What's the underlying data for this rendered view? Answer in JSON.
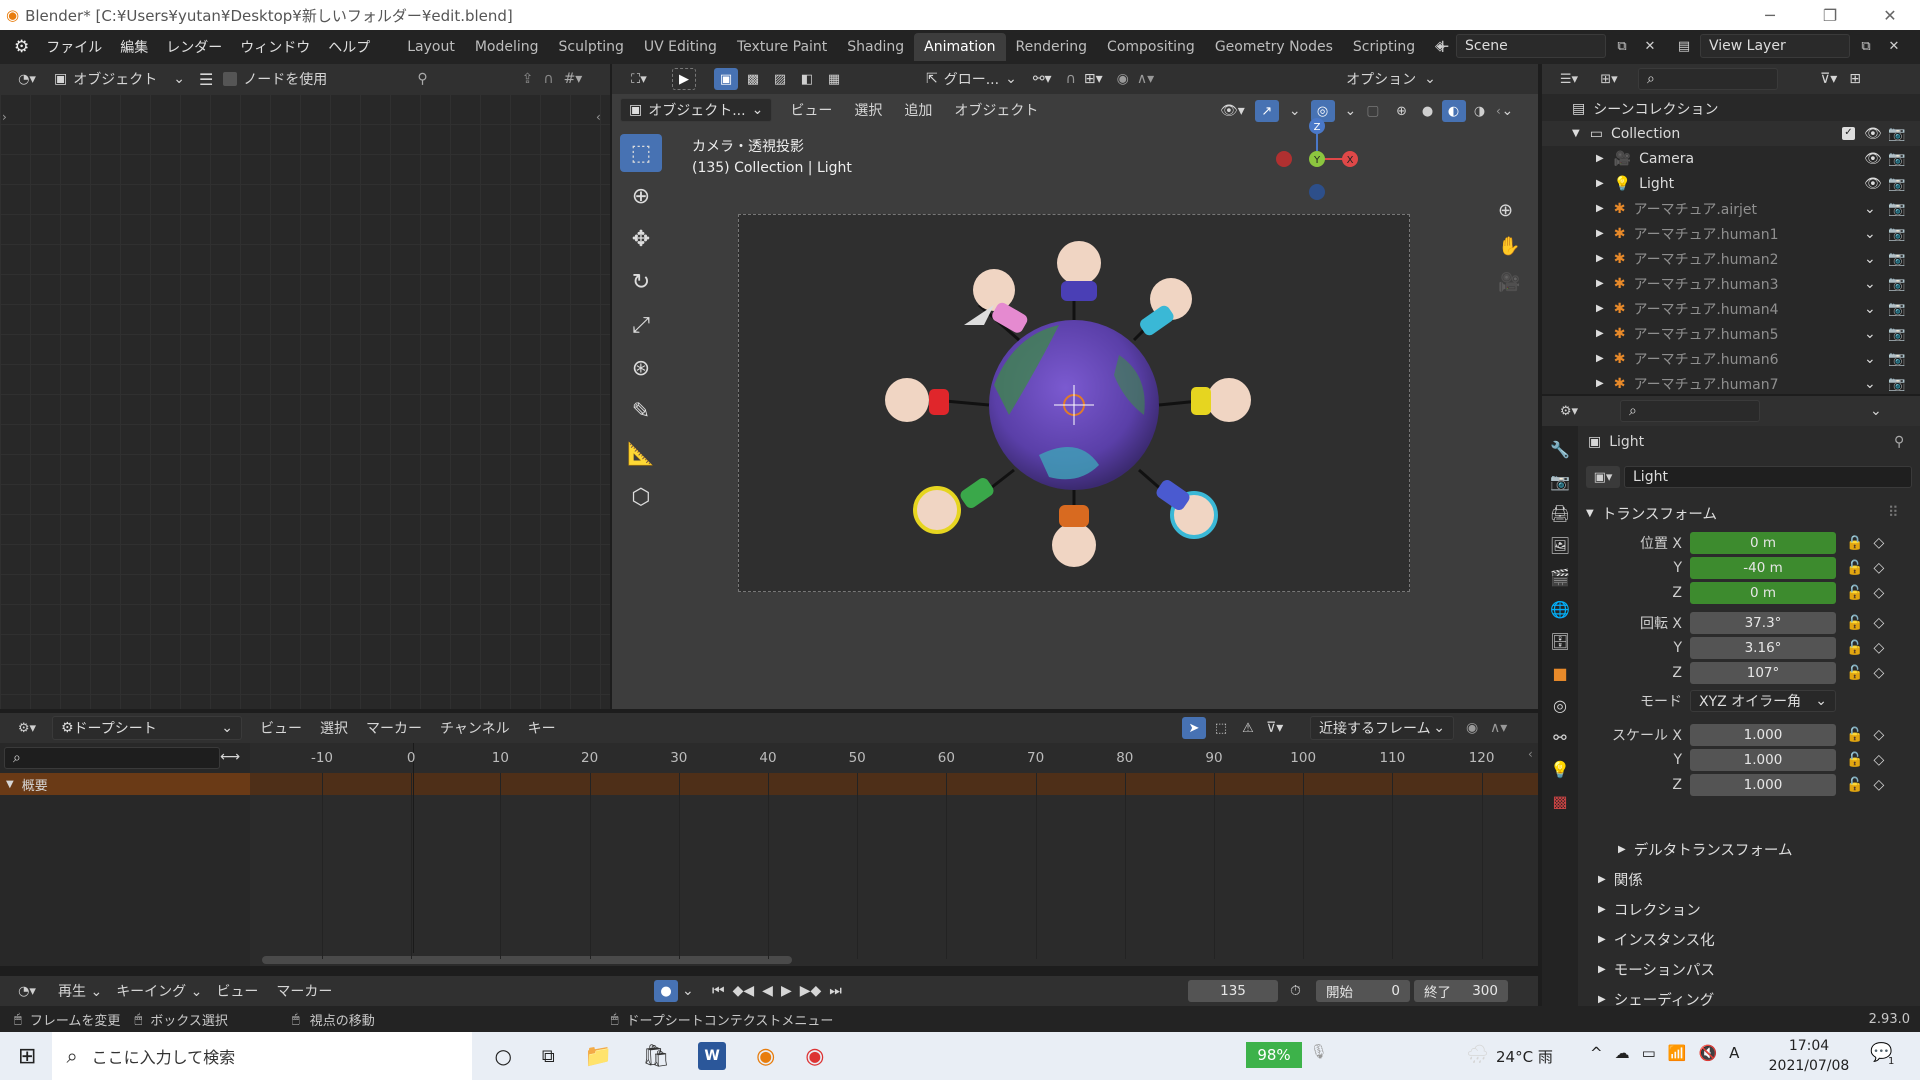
{
  "window": {
    "title": "Blender* [C:¥Users¥yutan¥Desktop¥新しいフォルダー¥edit.blend]"
  },
  "menu": [
    "ファイル",
    "編集",
    "レンダー",
    "ウィンドウ",
    "ヘルプ"
  ],
  "workspaces": [
    "Layout",
    "Modeling",
    "Sculpting",
    "UV Editing",
    "Texture Paint",
    "Shading",
    "Animation",
    "Rendering",
    "Compositing",
    "Geometry Nodes",
    "Scripting"
  ],
  "active_workspace": "Animation",
  "scene": "Scene",
  "view_layer": "View Layer",
  "left_editor": {
    "mode": "オブジェクト",
    "use_nodes": "ノードを使用"
  },
  "viewport": {
    "mode": "オブジェクト...",
    "menus": [
      "ビュー",
      "選択",
      "追加",
      "オブジェクト"
    ],
    "transform_orient": "グロー...",
    "options": "オプション",
    "camera_label": "カメラ・透視投影",
    "collection_label": "(135) Collection | Light",
    "gizmo": {
      "z": "Z",
      "y": "Y",
      "x": "X"
    }
  },
  "outliner": {
    "root": "シーンコレクション",
    "collection": "Collection",
    "items": [
      "Camera",
      "Light",
      "アーマチュア.airjet",
      "アーマチュア.human1",
      "アーマチュア.human2",
      "アーマチュア.human3",
      "アーマチュア.human4",
      "アーマチュア.human5",
      "アーマチュア.human6",
      "アーマチュア.human7"
    ]
  },
  "properties": {
    "object_name": "Light",
    "data_name": "Light",
    "transform": "トランスフォーム",
    "location_label": "位置 X",
    "location": {
      "x": "0 m",
      "y": "-40 m",
      "z": "0 m"
    },
    "rotation_label": "回転 X",
    "rotation": {
      "x": "37.3°",
      "y": "3.16°",
      "z": "107°"
    },
    "mode_label": "モード",
    "mode": "XYZ オイラー角",
    "scale_label": "スケール X",
    "scale": {
      "x": "1.000",
      "y": "1.000",
      "z": "1.000"
    },
    "y": "Y",
    "z": "Z",
    "sections": [
      "デルタトランスフォーム",
      "関係",
      "コレクション",
      "インスタンス化",
      "モーションパス",
      "シェーディング"
    ]
  },
  "dopesheet": {
    "editor": "ドープシート",
    "menus": [
      "ビュー",
      "選択",
      "マーカー",
      "チャンネル",
      "キー"
    ],
    "snap": "近接するフレーム",
    "summary": "概要",
    "ticks": [
      "-10",
      "0",
      "10",
      "20",
      "30",
      "40",
      "50",
      "60",
      "70",
      "80",
      "90",
      "100",
      "110",
      "120"
    ]
  },
  "timeline": {
    "menus": [
      "再生",
      "キーイング",
      "ビュー",
      "マーカー"
    ],
    "current_frame": "135",
    "start_label": "開始",
    "start": "0",
    "end_label": "終了",
    "end": "300"
  },
  "statusbar": {
    "items": [
      "フレームを変更",
      "ボックス選択",
      "視点の移動",
      "ドープシートコンテクストメニュー"
    ],
    "version": "2.93.0"
  },
  "taskbar": {
    "search": "ここに入力して検索",
    "battery": "98%",
    "weather": "24°C 雨",
    "ime": "A",
    "time": "17:04",
    "date": "2021/07/08",
    "notifications": "1"
  }
}
